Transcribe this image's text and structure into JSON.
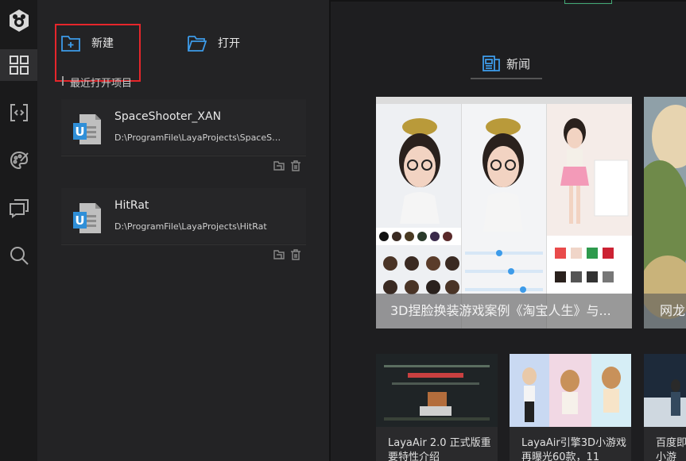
{
  "sidebar": {
    "items": [
      {
        "icon": "grid-icon",
        "active": true
      },
      {
        "icon": "code-bracket-icon",
        "active": false
      },
      {
        "icon": "palette-icon",
        "active": false
      },
      {
        "icon": "chat-icon",
        "active": false
      },
      {
        "icon": "search-icon",
        "active": false
      }
    ]
  },
  "actions": {
    "new_label": "新建",
    "open_label": "打开"
  },
  "recent": {
    "title": "最近打开项目",
    "projects": [
      {
        "name": "SpaceShooter_XAN",
        "path": "D:\\ProgramFile\\LayaProjects\\SpaceShooter_XAN"
      },
      {
        "name": "HitRat",
        "path": "D:\\ProgramFile\\LayaProjects\\HitRat"
      }
    ]
  },
  "news": {
    "tab_label": "新闻",
    "featured": [
      {
        "caption": "3D捏脸换装游戏案例《淘宝人生》与..."
      },
      {
        "caption": "网龙"
      }
    ],
    "articles": [
      {
        "caption": "LayaAir 2.0 正式版重要特性介绍"
      },
      {
        "caption": "LayaAir引擎3D小游戏再曝光60款，11"
      },
      {
        "caption": "百度即小游"
      }
    ]
  },
  "colors": {
    "accent": "#3d9be9",
    "highlight": "#e5262b"
  }
}
